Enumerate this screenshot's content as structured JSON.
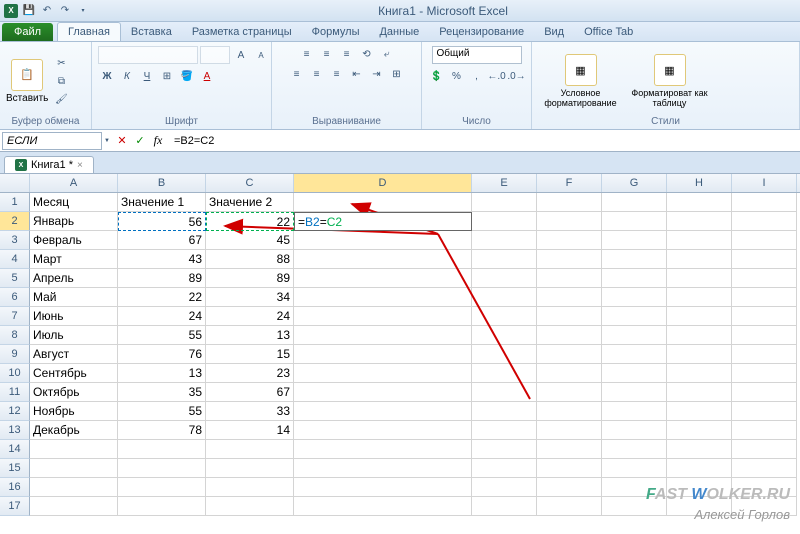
{
  "title": "Книга1 - Microsoft Excel",
  "qat": {
    "save": "💾",
    "undo": "↶",
    "redo": "↷",
    "more": "▾"
  },
  "file_btn": "Файл",
  "tabs": [
    "Главная",
    "Вставка",
    "Разметка страницы",
    "Формулы",
    "Данные",
    "Рецензирование",
    "Вид",
    "Office Tab"
  ],
  "active_tab": 0,
  "ribbon_groups": {
    "clipboard": {
      "paste": "Вставить",
      "label": "Буфер обмена"
    },
    "font": {
      "label": "Шрифт",
      "bold": "Ж",
      "italic": "К",
      "underline": "Ч",
      "sample": "A"
    },
    "align": {
      "label": "Выравнивание"
    },
    "number": {
      "label": "Число",
      "format": "Общий"
    },
    "styles": {
      "label": "Стили",
      "cond": "Условное форматирование",
      "table": "Форматироват как таблицу"
    }
  },
  "namebox": "ЕСЛИ",
  "formula": {
    "raw": "=B2=C2",
    "eq1": "=",
    "ref1": "B2",
    "eq2": "=",
    "ref2": "C2"
  },
  "fb_icons": {
    "cancel": "✕",
    "enter": "✓",
    "fx": "fx"
  },
  "workbook_tab": "Книга1 *",
  "cols": [
    "A",
    "B",
    "C",
    "D",
    "E",
    "F",
    "G",
    "H",
    "I"
  ],
  "active_col_idx": 3,
  "active_row_idx": 1,
  "rows": [
    {
      "n": 1,
      "a": "Месяц",
      "b": "Значение 1",
      "c": "Значение 2"
    },
    {
      "n": 2,
      "a": "Январь",
      "b": "56",
      "c": "22"
    },
    {
      "n": 3,
      "a": "Февраль",
      "b": "67",
      "c": "45"
    },
    {
      "n": 4,
      "a": "Март",
      "b": "43",
      "c": "88"
    },
    {
      "n": 5,
      "a": "Апрель",
      "b": "89",
      "c": "89"
    },
    {
      "n": 6,
      "a": "Май",
      "b": "22",
      "c": "34"
    },
    {
      "n": 7,
      "a": "Июнь",
      "b": "24",
      "c": "24"
    },
    {
      "n": 8,
      "a": "Июль",
      "b": "55",
      "c": "13"
    },
    {
      "n": 9,
      "a": "Август",
      "b": "76",
      "c": "15"
    },
    {
      "n": 10,
      "a": "Сентябрь",
      "b": "13",
      "c": "23"
    },
    {
      "n": 11,
      "a": "Октябрь",
      "b": "35",
      "c": "67"
    },
    {
      "n": 12,
      "a": "Ноябрь",
      "b": "55",
      "c": "33"
    },
    {
      "n": 13,
      "a": "Декабрь",
      "b": "78",
      "c": "14"
    },
    {
      "n": 14
    },
    {
      "n": 15
    },
    {
      "n": 16
    },
    {
      "n": 17
    }
  ],
  "watermark1": {
    "f": "F",
    "ast": "AST",
    "w": " W",
    "olker": "OLKER.RU"
  },
  "watermark2": "Алексей Горлов"
}
